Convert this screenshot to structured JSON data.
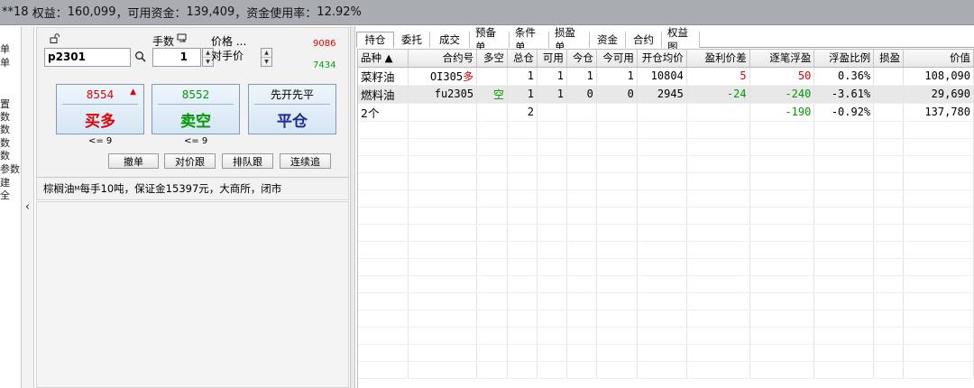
{
  "account": {
    "prefix": "**18",
    "equity_label": "权益：",
    "equity": "160,099",
    "available_label": "可用资金：",
    "available": "139,409",
    "usage_label": "资金使用率：",
    "usage": "12.92%"
  },
  "left_strip": {
    "glyphs": [
      "单",
      "单",
      "置",
      "数",
      "数",
      "数",
      "数",
      "参数",
      "建",
      "全"
    ]
  },
  "order": {
    "contract_code": "p2301",
    "qty_label": "手数",
    "qty_value": "1",
    "price_label": "价格 ...",
    "price_value": "对手价",
    "ask_quote": "9086",
    "bid_quote": "7434",
    "buy": {
      "price": "8554",
      "action": "买多",
      "limit": "<= 9",
      "color": "#e00000"
    },
    "sell": {
      "price": "8552",
      "action": "卖空",
      "limit": "<= 9",
      "color": "#009900"
    },
    "close": {
      "top": "先开先平",
      "action": "平仓",
      "color": "#1a2a9a"
    },
    "buttons": [
      "撤单",
      "对价跟",
      "排队跟",
      "连续追"
    ],
    "info": "棕榈油",
    "info_sup": "M",
    "info_rest": " 每手10吨，保证金15397元，大商所，闭市"
  },
  "tabs": [
    "持仓",
    "委托",
    "成交",
    "预备单",
    "条件单",
    "损盈单",
    "资金",
    "合约",
    "权益图"
  ],
  "table": {
    "headers": [
      "品种 ▲",
      "合约号",
      "多空",
      "总仓",
      "可用",
      "今仓",
      "今可用",
      "开仓均价",
      "盈利价差",
      "逐笔浮盈",
      "浮盈比例",
      "损盈",
      "价值"
    ],
    "rows": [
      {
        "name": "菜籽油",
        "code": "OI305",
        "side": "多",
        "total": "1",
        "avail": "1",
        "today": "1",
        "today_avail": "1",
        "avg": "10804",
        "diff": "5",
        "float": "50",
        "ratio": "0.36%",
        "sl": "",
        "value": "108,090"
      },
      {
        "name": "燃料油",
        "code": "fu2305",
        "side": "空",
        "total": "1",
        "avail": "1",
        "today": "0",
        "today_avail": "0",
        "avg": "2945",
        "diff": "-24",
        "float": "-240",
        "ratio": "-3.61%",
        "sl": "",
        "value": "29,690"
      },
      {
        "name": "2个",
        "code": "",
        "side": "",
        "total": "2",
        "avail": "",
        "today": "",
        "today_avail": "",
        "avg": "",
        "diff": "",
        "float": "-190",
        "ratio": "-0.92%",
        "sl": "",
        "value": "137,780"
      }
    ]
  }
}
